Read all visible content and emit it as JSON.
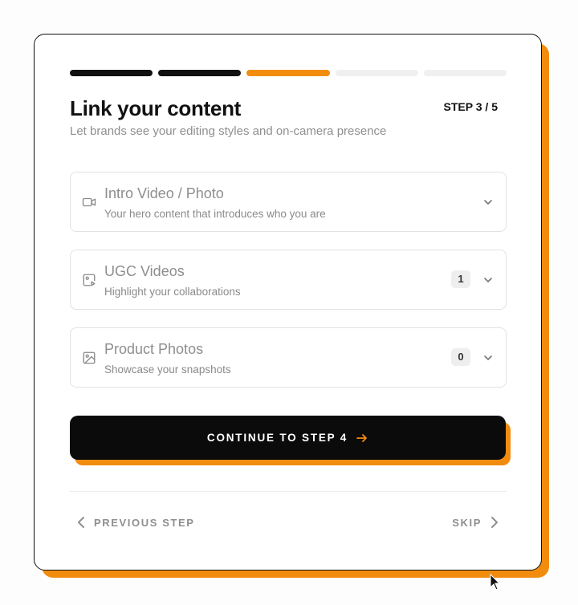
{
  "colors": {
    "accent": "#f28c0f",
    "dark": "#111111",
    "muted_text": "#8f8f8f",
    "track": "#f0f0f0"
  },
  "progress": {
    "current": 3,
    "total": 5,
    "segments": [
      "done",
      "done",
      "active",
      "pending",
      "pending"
    ]
  },
  "header": {
    "title": "Link your content",
    "step_counter": "STEP 3 / 5",
    "subtitle": "Let brands see your editing styles and on-camera presence"
  },
  "sections": [
    {
      "icon": "video-camera-icon",
      "title": "Intro Video / Photo",
      "description": "Your hero content that introduces who you are",
      "count": null
    },
    {
      "icon": "media-play-icon",
      "title": "UGC Videos",
      "description": "Highlight your collaborations",
      "count": "1"
    },
    {
      "icon": "image-icon",
      "title": "Product Photos",
      "description": "Showcase your snapshots",
      "count": "0"
    }
  ],
  "actions": {
    "continue_label": "CONTINUE TO STEP 4",
    "previous_label": "PREVIOUS STEP",
    "skip_label": "SKIP"
  }
}
